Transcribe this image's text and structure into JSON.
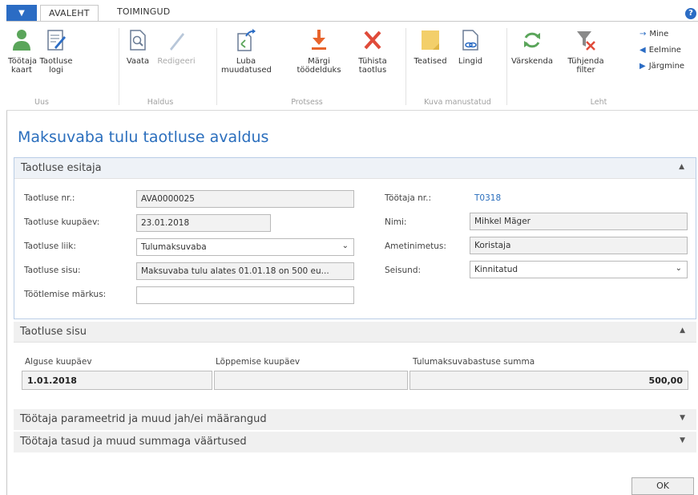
{
  "ribbon": {
    "app_menu_icon": "dropdown-arrow",
    "tabs": [
      "AVALEHT",
      "TOIMINGUD"
    ],
    "help_icon": "question-icon",
    "groups": [
      {
        "label": "Uus",
        "buttons": [
          {
            "label1": "Töötaja",
            "label2": "kaart",
            "icon": "person-icon"
          },
          {
            "label1": "Taotluse",
            "label2": "logi",
            "icon": "log-edit-icon"
          }
        ]
      },
      {
        "label": "Haldus",
        "buttons": [
          {
            "label1": "Vaata",
            "label2": "",
            "icon": "view-document-icon"
          },
          {
            "label1": "Redigeeri",
            "label2": "",
            "icon": "edit-pencil-icon"
          }
        ]
      },
      {
        "label": "Protsess",
        "buttons": [
          {
            "label1": "Luba",
            "label2": "muudatused",
            "icon": "allow-changes-icon"
          },
          {
            "label1": "Märgi",
            "label2": "töödelduks",
            "icon": "mark-processed-icon"
          },
          {
            "label1": "Tühista",
            "label2": "taotlus",
            "icon": "cancel-x-icon"
          }
        ]
      },
      {
        "label": "Kuva manustatud",
        "buttons": [
          {
            "label1": "Teatised",
            "label2": "",
            "icon": "notes-icon"
          },
          {
            "label1": "Lingid",
            "label2": "",
            "icon": "links-icon"
          }
        ]
      },
      {
        "label": "Leht",
        "buttons": [
          {
            "label1": "Värskenda",
            "label2": "",
            "icon": "refresh-icon"
          },
          {
            "label1": "Tühjenda",
            "label2": "filter",
            "icon": "clear-filter-icon"
          }
        ]
      }
    ],
    "nav": [
      "Mine",
      "Eelmine",
      "Järgmine"
    ]
  },
  "page": {
    "title": "Maksuvaba tulu taotluse avaldus"
  },
  "sections": {
    "applicant": {
      "title": "Taotluse esitaja",
      "fields": {
        "nr_label": "Taotluse nr.:",
        "nr_value": "AVA0000025",
        "date_label": "Taotluse kuupäev:",
        "date_value": "23.01.2018",
        "type_label": "Taotluse liik:",
        "type_value": "Tulumaksuvaba",
        "content_label": "Taotluse sisu:",
        "content_value": "Maksuvaba tulu alates 01.01.18 on 500 eu...",
        "note_label": "Töötlemise märkus:",
        "note_value": "",
        "employee_nr_label": "Töötaja nr.:",
        "employee_nr_value": "T0318",
        "name_label": "Nimi:",
        "name_value": "Mihkel Mäger",
        "position_label": "Ametinimetus:",
        "position_value": "Koristaja",
        "status_label": "Seisund:",
        "status_value": "Kinnitatud"
      }
    },
    "content": {
      "title": "Taotluse sisu",
      "start_label": "Alguse kuupäev",
      "start_value": "1.01.2018",
      "end_label": "Lõppemise kuupäev",
      "end_value": "",
      "amount_label": "Tulumaksuvabastuse summa",
      "amount_value": "500,00"
    },
    "params": {
      "title": "Töötaja parameetrid ja muud jah/ei määrangud"
    },
    "payments": {
      "title": "Töötaja tasud ja muud summaga väärtused"
    }
  },
  "footer": {
    "ok_label": "OK"
  },
  "colors": {
    "accent": "#2b6cc4",
    "title": "#2a6ebd",
    "green": "#5aa55a",
    "red": "#e04b3a",
    "orange": "#e8642c"
  }
}
